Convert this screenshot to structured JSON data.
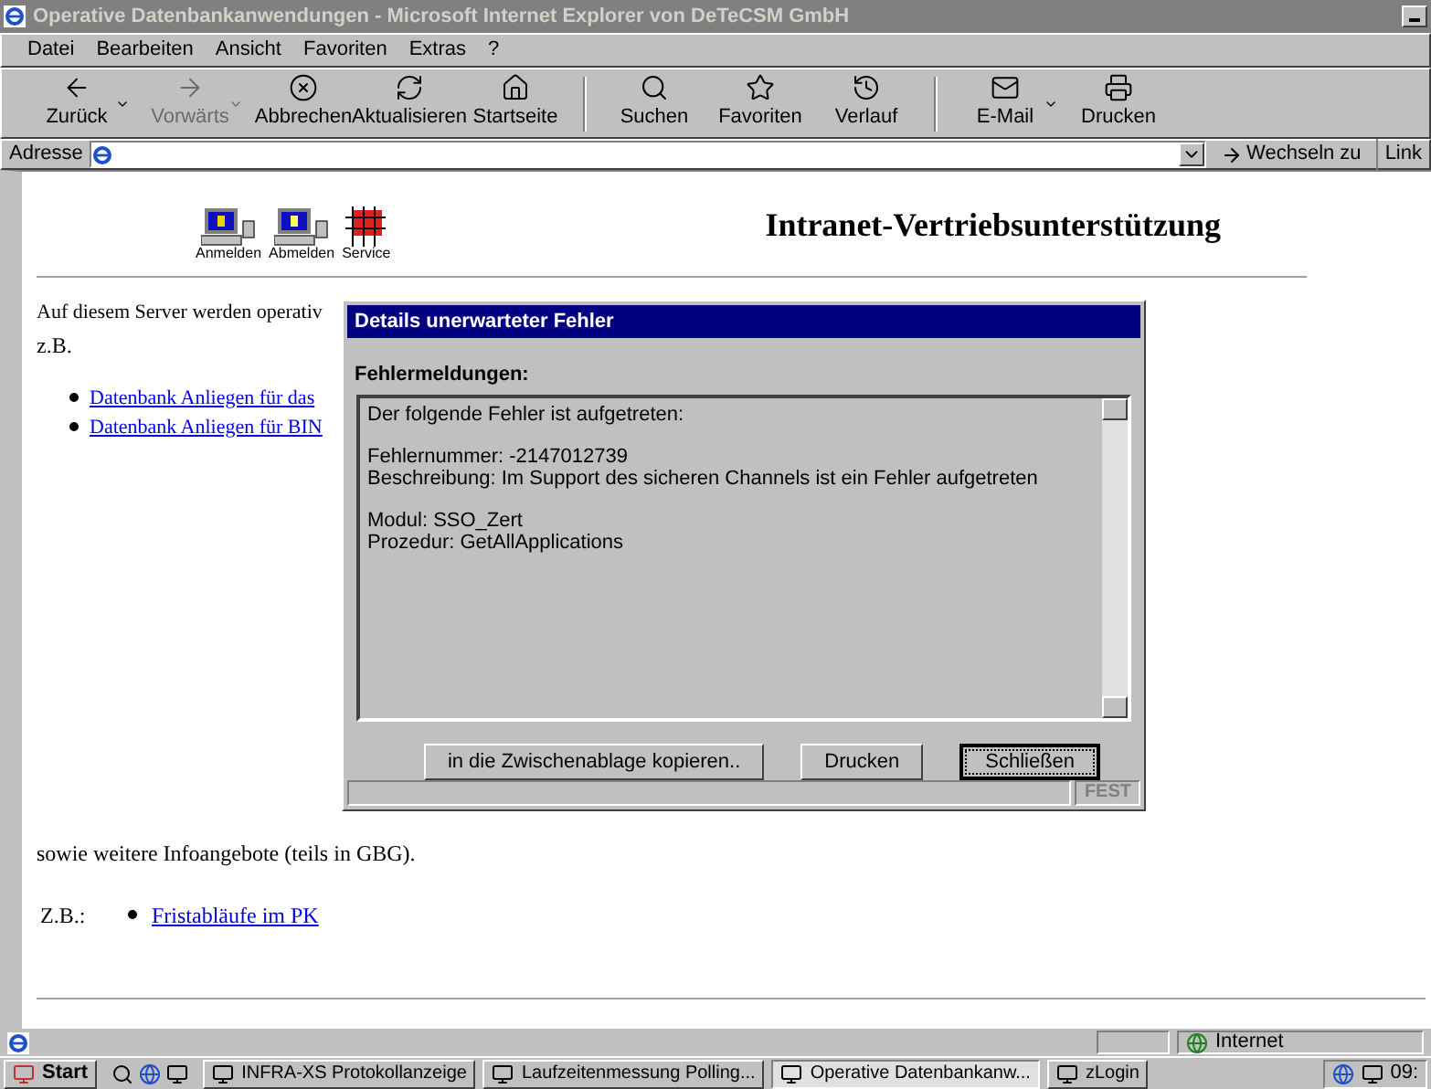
{
  "window": {
    "title": "Operative Datenbankanwendungen - Microsoft Internet Explorer von DeTeCSM GmbH"
  },
  "menu": [
    "Datei",
    "Bearbeiten",
    "Ansicht",
    "Favoriten",
    "Extras",
    "?"
  ],
  "toolbar": [
    {
      "label": "Zurück",
      "disabled": false,
      "dropdown": true
    },
    {
      "label": "Vorwärts",
      "disabled": true,
      "dropdown": true
    },
    {
      "label": "Abbrechen",
      "disabled": false,
      "dropdown": false
    },
    {
      "label": "Aktualisieren",
      "disabled": false,
      "dropdown": false
    },
    {
      "label": "Startseite",
      "disabled": false,
      "dropdown": false
    },
    {
      "label": "Suchen",
      "disabled": false,
      "dropdown": false
    },
    {
      "label": "Favoriten",
      "disabled": false,
      "dropdown": false
    },
    {
      "label": "Verlauf",
      "disabled": false,
      "dropdown": false
    },
    {
      "label": "E-Mail",
      "disabled": false,
      "dropdown": true
    },
    {
      "label": "Drucken",
      "disabled": false,
      "dropdown": false
    }
  ],
  "address_bar": {
    "label": "Adresse",
    "go": "Wechseln zu",
    "links": "Link"
  },
  "page": {
    "nav_icons": [
      "Anmelden",
      "Abmelden",
      "Service"
    ],
    "heading": "Intranet-Vertriebsunterstützung",
    "intro": "Auf diesem Server werden operativ",
    "intro_2": "z.B.",
    "links": [
      "Datenbank Anliegen für das",
      "Datenbank Anliegen für BIN"
    ],
    "more": "sowie weitere Infoangebote (teils in GBG).",
    "example_label": "Z.B.:",
    "example_links": [
      "Fristabläufe im PK"
    ]
  },
  "dialog": {
    "title": "Details unerwarteter Fehler",
    "section": "Fehlermeldungen:",
    "message": [
      [
        "Der folgende Fehler ist aufgetreten:"
      ],
      [
        "Fehlernummer: -2147012739",
        "Beschreibung: Im Support des sicheren Channels ist ein Fehler aufgetreten"
      ],
      [
        "Modul: SSO_Zert",
        "Prozedur: GetAllApplications"
      ]
    ],
    "buttons": [
      {
        "label": "in die Zwischenablage kopieren..",
        "default": false
      },
      {
        "label": "Drucken",
        "default": false
      },
      {
        "label": "Schließen",
        "default": true
      }
    ],
    "status": "FEST"
  },
  "status_bar": {
    "zone": "Internet"
  },
  "taskbar": {
    "start": "Start",
    "tasks": [
      {
        "label": "INFRA-XS Protokollanzeige",
        "selected": false
      },
      {
        "label": "Laufzeitenmessung Polling...",
        "selected": false
      },
      {
        "label": "Operative Datenbankanw...",
        "selected": true
      },
      {
        "label": "zLogin",
        "selected": false
      }
    ],
    "clock": "09:"
  }
}
